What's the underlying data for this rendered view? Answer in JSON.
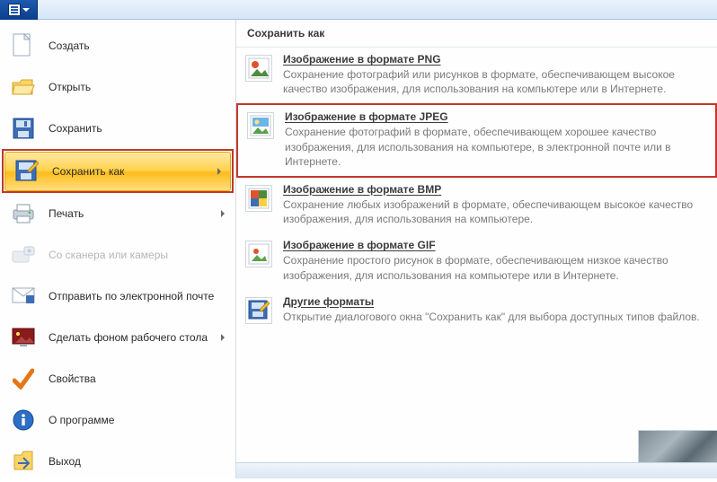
{
  "sidebar": {
    "items": [
      {
        "label": "Создать"
      },
      {
        "label": "Открыть"
      },
      {
        "label": "Сохранить"
      },
      {
        "label": "Сохранить как",
        "selected": true,
        "arrow": true
      },
      {
        "label": "Печать",
        "arrow": true
      },
      {
        "label": "Со сканера или камеры",
        "disabled": true
      },
      {
        "label": "Отправить по электронной почте"
      },
      {
        "label": "Сделать фоном рабочего стола",
        "arrow": true
      },
      {
        "label": "Свойства"
      },
      {
        "label": "О программе"
      },
      {
        "label": "Выход"
      }
    ]
  },
  "panel": {
    "title": "Сохранить как",
    "options": [
      {
        "title": "Изображение в формате PNG",
        "desc": "Сохранение фотографий или рисунков в формате, обеспечивающем высокое качество изображения, для использования на компьютере или в Интернете."
      },
      {
        "title": "Изображение в формате JPEG",
        "desc": "Сохранение фотографий в формате, обеспечивающем хорошее качество изображения, для использования на компьютере, в электронной почте или в Интернете.",
        "highlight": true
      },
      {
        "title": "Изображение в формате BMP",
        "desc": "Сохранение любых изображений в формате, обеспечивающем высокое качество изображения, для использования на компьютере."
      },
      {
        "title": "Изображение в формате GIF",
        "desc": "Сохранение простого рисунок в формате, обеспечивающем низкое качество изображения, для использования на компьютере или в Интернете."
      },
      {
        "title": "Другие форматы",
        "desc": "Открытие диалогового окна \"Сохранить как\" для выбора доступных типов файлов."
      }
    ]
  }
}
